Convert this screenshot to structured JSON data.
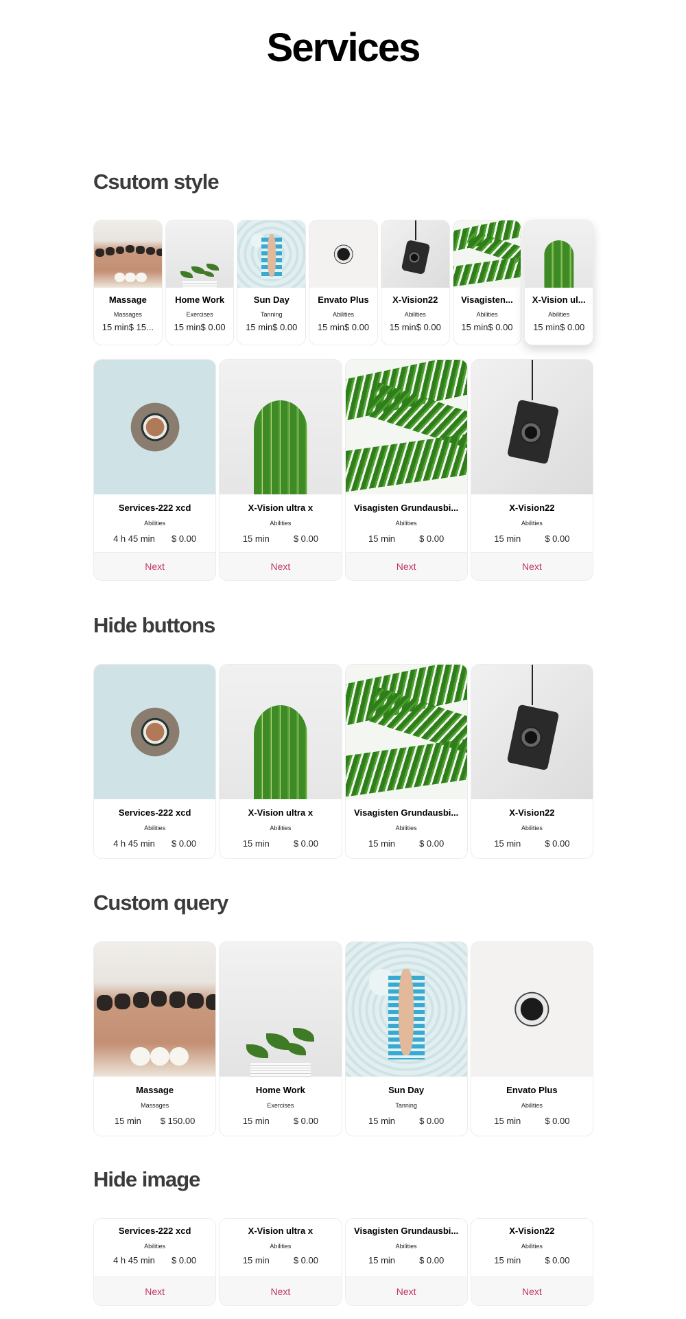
{
  "page": {
    "title": "Services"
  },
  "sections": {
    "custom_style": {
      "title": "Csutom style"
    },
    "hide_buttons": {
      "title": "Hide buttons"
    },
    "custom_query": {
      "title": "Custom query"
    },
    "hide_image": {
      "title": "Hide image"
    }
  },
  "small_row": [
    {
      "name": "Massage",
      "category": "Massages",
      "duration": "15 min",
      "price": "$ 15...",
      "image": "massage"
    },
    {
      "name": "Home Work",
      "category": "Exercises",
      "duration": "15 min",
      "price": "$ 0.00",
      "image": "homework"
    },
    {
      "name": "Sun Day",
      "category": "Tanning",
      "duration": "15 min",
      "price": "$ 0.00",
      "image": "sunday"
    },
    {
      "name": "Envato Plus",
      "category": "Abilities",
      "duration": "15 min",
      "price": "$ 0.00",
      "image": "coffee-white"
    },
    {
      "name": "X-Vision22",
      "category": "Abilities",
      "duration": "15 min",
      "price": "$ 0.00",
      "image": "camera"
    },
    {
      "name": "Visagisten...",
      "category": "Abilities",
      "duration": "15 min",
      "price": "$ 0.00",
      "image": "palm"
    },
    {
      "name": "X-Vision ul...",
      "category": "Abilities",
      "duration": "15 min",
      "price": "$ 0.00",
      "image": "cactus"
    }
  ],
  "next_label": "Next",
  "big_row": [
    {
      "name": "Services-222 xcd",
      "category": "Abilities",
      "duration": "4 h 45 min",
      "price": "$ 0.00",
      "image": "coffee-blue"
    },
    {
      "name": "X-Vision ultra x",
      "category": "Abilities",
      "duration": "15 min",
      "price": "$ 0.00",
      "image": "cactus"
    },
    {
      "name": "Visagisten Grundausbi...",
      "category": "Abilities",
      "duration": "15 min",
      "price": "$ 0.00",
      "image": "palm"
    },
    {
      "name": "X-Vision22",
      "category": "Abilities",
      "duration": "15 min",
      "price": "$ 0.00",
      "image": "camera"
    }
  ],
  "query_row": [
    {
      "name": "Massage",
      "category": "Massages",
      "duration": "15 min",
      "price": "$ 150.00",
      "image": "massage"
    },
    {
      "name": "Home Work",
      "category": "Exercises",
      "duration": "15 min",
      "price": "$ 0.00",
      "image": "homework"
    },
    {
      "name": "Sun Day",
      "category": "Tanning",
      "duration": "15 min",
      "price": "$ 0.00",
      "image": "sunday"
    },
    {
      "name": "Envato Plus",
      "category": "Abilities",
      "duration": "15 min",
      "price": "$ 0.00",
      "image": "coffee-white"
    }
  ],
  "colors": {
    "accent": "#c0365e",
    "title": "#000000",
    "section_title": "#3b3b3b",
    "card_border": "#ececec",
    "footer_bg": "#f7f7f7"
  }
}
